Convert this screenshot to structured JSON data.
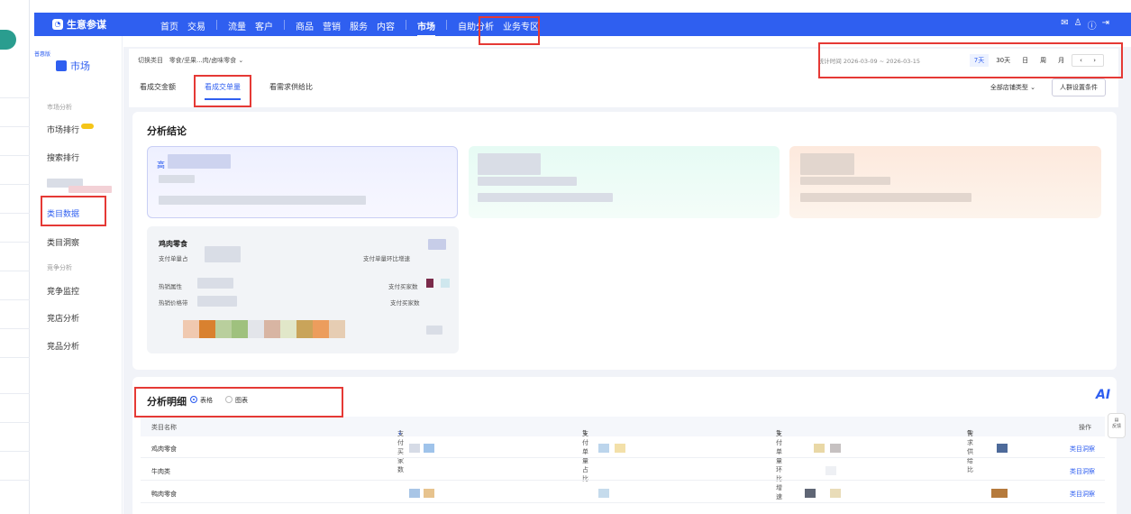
{
  "topnav": {
    "brand": "生意参谋",
    "items": [
      "首页",
      "交易",
      "流量",
      "客户",
      "商品",
      "营销",
      "服务",
      "内容",
      "市场",
      "自助分析",
      "业务专区"
    ],
    "active": "市场"
  },
  "sidebar": {
    "version": "普惠版",
    "module": "市场",
    "group1": "市场分析",
    "items1": [
      "市场排行",
      "搜索排行"
    ],
    "selected": "类目数据",
    "items2": [
      "类目洞察"
    ],
    "group2": "竞争分析",
    "items3": [
      "竞争监控",
      "竞店分析",
      "竞品分析"
    ]
  },
  "header": {
    "category_label": "切换类目",
    "category_value": "零食/坚果...肉/卤味零食",
    "date_range": "统计时间 2026-03-09 ~ 2026-03-15",
    "periods": [
      "7天",
      "30天",
      "日",
      "周",
      "月"
    ],
    "active_period": "7天",
    "tabs": [
      "看成交金额",
      "看成交单量",
      "看需求供给比"
    ],
    "active_tab": "看成交单量",
    "shop_type": "全部店铺类型",
    "crowd_button": "人群设置条件"
  },
  "conclusion": {
    "title": "分析结论",
    "card1_prefix": "高",
    "detail_title": "鸡肉零食",
    "labels": [
      "支付单量占",
      "支付单量环比增速",
      "热销属性",
      "支付买家数",
      "热销价格带",
      "支付买家数"
    ]
  },
  "detail": {
    "title": "分析明细",
    "radio_table": "表格",
    "radio_chart": "图表",
    "columns": [
      "类目名称",
      "支付买家数",
      "支付单量占比",
      "支付单量环比增速",
      "需求供给比",
      "操作"
    ],
    "rows": [
      {
        "name": "鸡肉零食",
        "action": "类目洞察"
      },
      {
        "name": "牛肉类",
        "action": "类目洞察"
      },
      {
        "name": "鸭肉零食",
        "action": "类目洞察"
      }
    ]
  },
  "float": {
    "ai": "AI",
    "feedback": "反馈"
  }
}
